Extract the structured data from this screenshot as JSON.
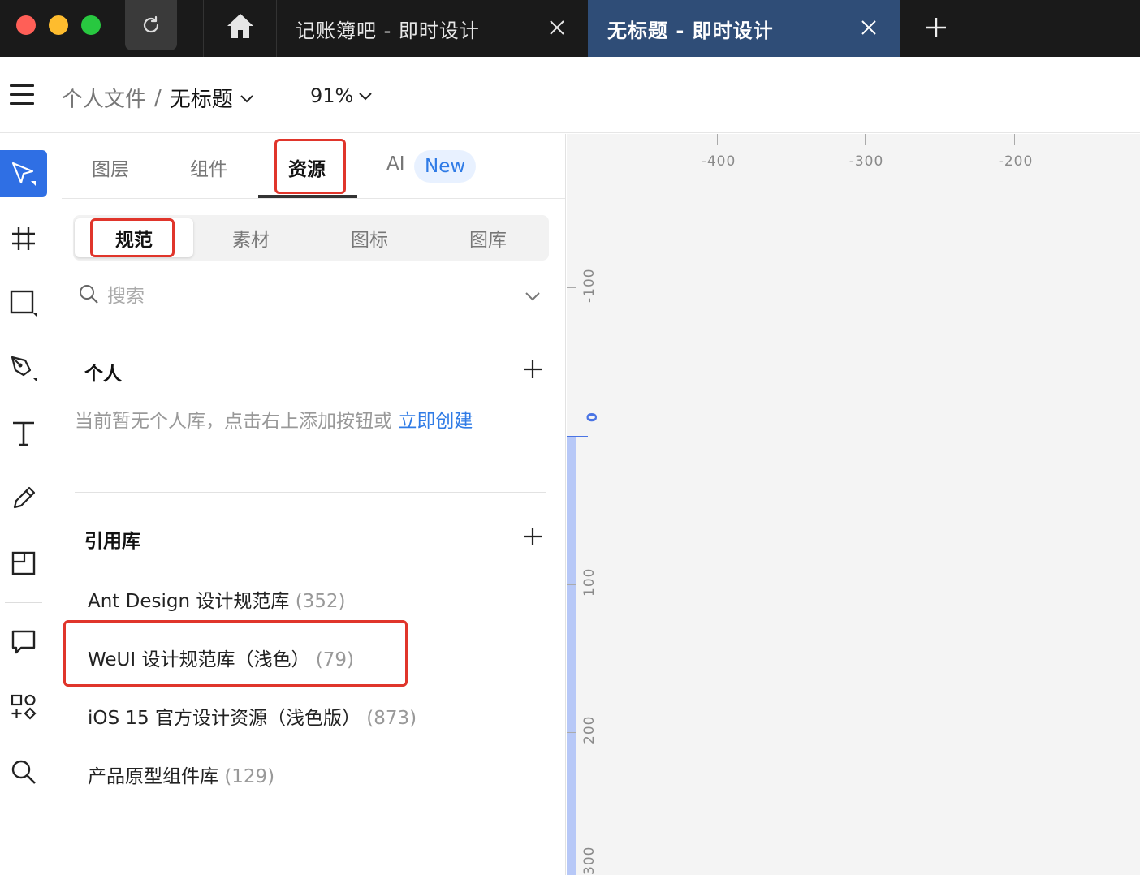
{
  "tabs": [
    {
      "label": "记账簿吧 - 即时设计",
      "active": false
    },
    {
      "label": "无标题 - 即时设计",
      "active": true
    }
  ],
  "toolbar": {
    "breadcrumb_parent": "个人文件",
    "breadcrumb_sep": "/",
    "breadcrumb_current": "无标题",
    "zoom": "91%"
  },
  "panel_tabs": {
    "layers": "图层",
    "components": "组件",
    "assets": "资源",
    "ai": "AI",
    "ai_badge": "New"
  },
  "segments": {
    "spec": "规范",
    "material": "素材",
    "icons": "图标",
    "gallery": "图库"
  },
  "search": {
    "placeholder": "搜索"
  },
  "personal": {
    "title": "个人",
    "empty_text": "当前暂无个人库，点击右上添加按钮或",
    "empty_link": "立即创建"
  },
  "referenced": {
    "title": "引用库",
    "libraries": [
      {
        "name": "Ant Design 设计规范库",
        "count": "(352)"
      },
      {
        "name": "WeUI 设计规范库（浅色）",
        "count": "(79)"
      },
      {
        "name": "iOS 15 官方设计资源（浅色版）",
        "count": "(873)"
      },
      {
        "name": "产品原型组件库",
        "count": "(129)"
      }
    ]
  },
  "rulers": {
    "top": [
      "-400",
      "-300",
      "-200"
    ],
    "left": [
      "-100",
      "0",
      "100",
      "200",
      "300"
    ]
  },
  "colors": {
    "accent": "#2f6fe4",
    "active_tab": "#2f4d77",
    "highlight_box": "#e0352b",
    "link": "#2f7be6"
  }
}
